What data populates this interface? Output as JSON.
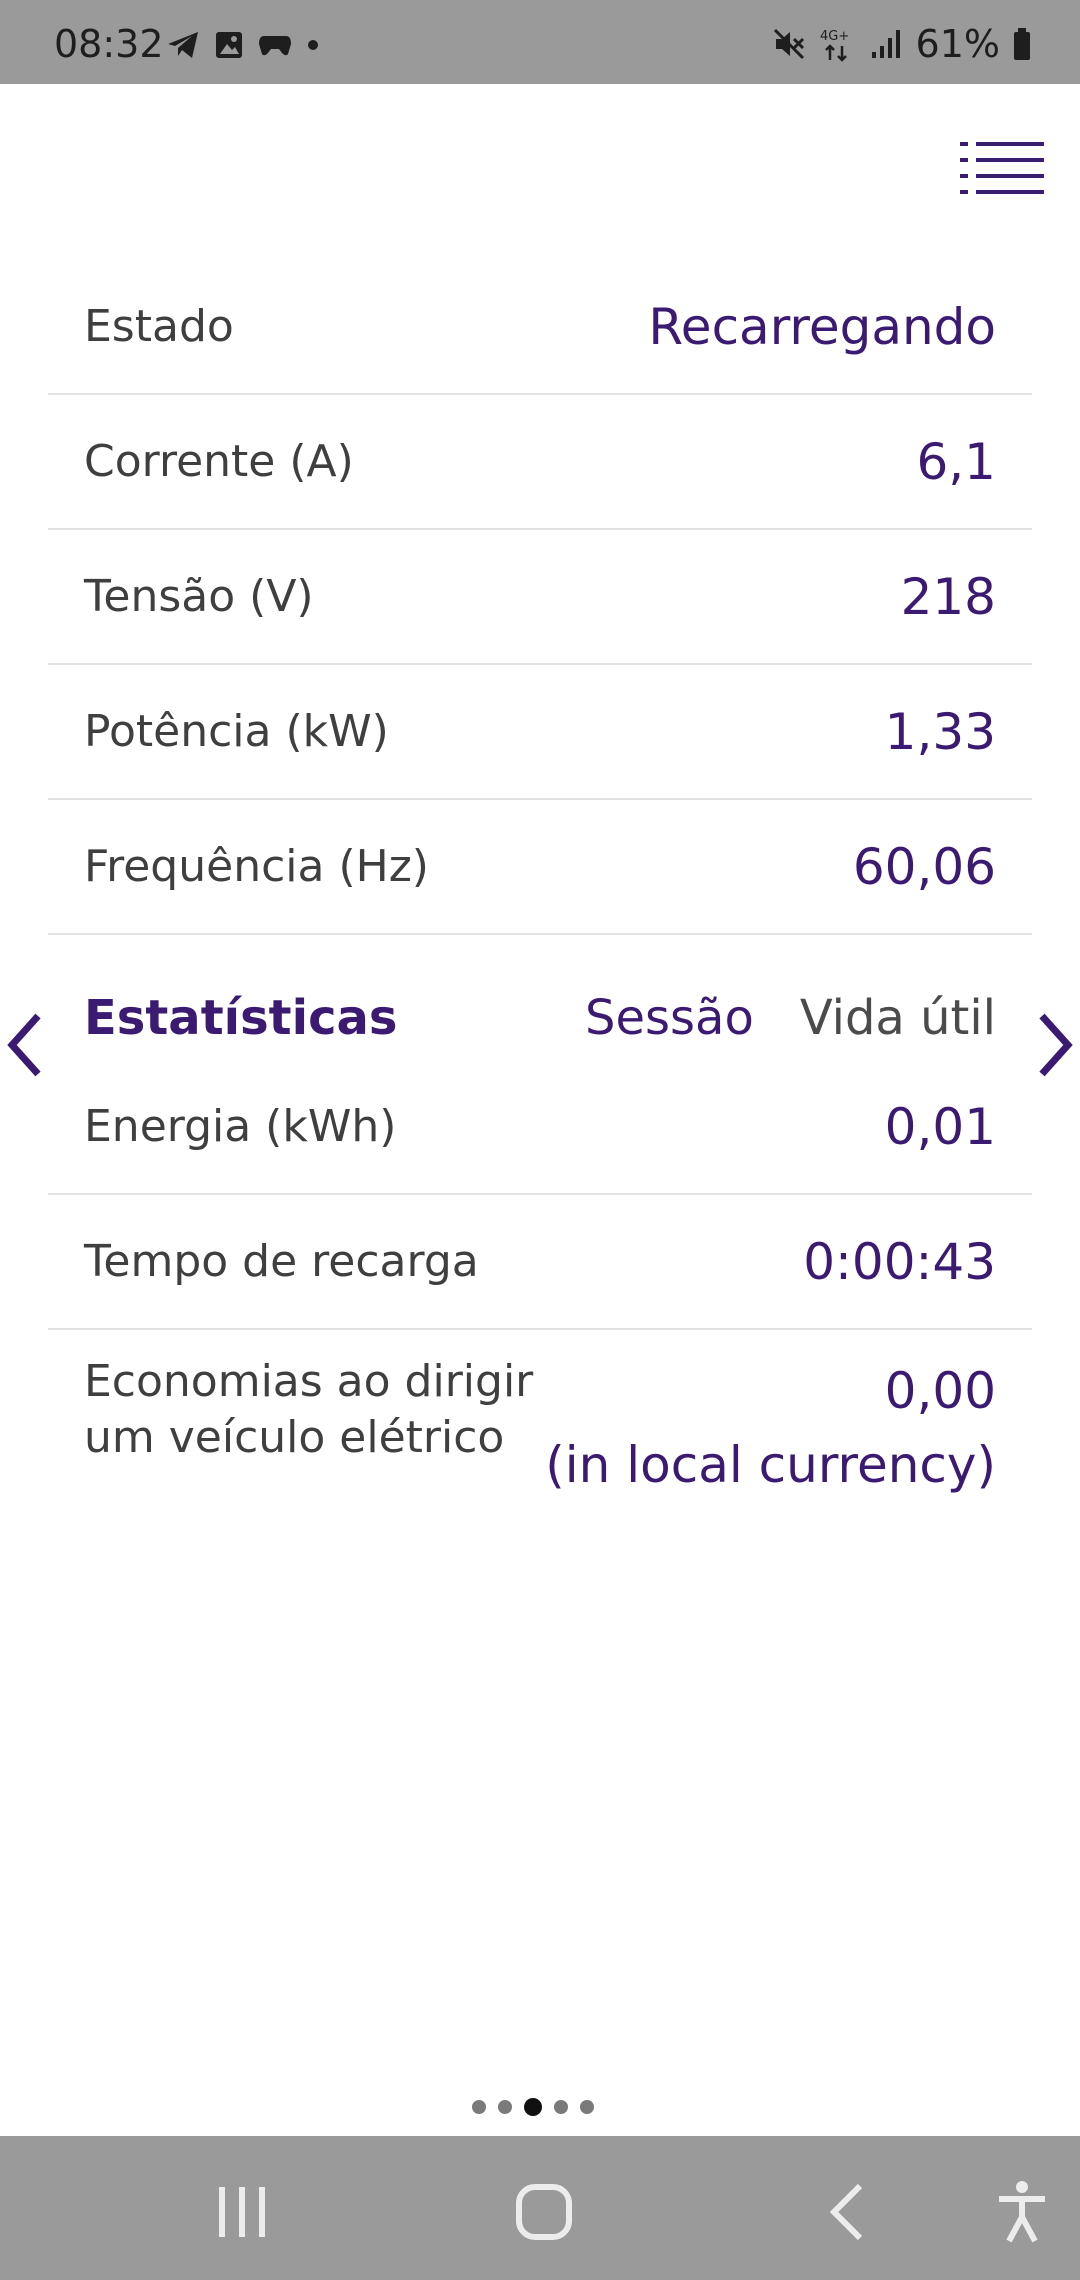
{
  "status_bar": {
    "time": "08:32",
    "battery": "61%",
    "network": "4G+",
    "left_icons": [
      "telegram-icon",
      "gallery-icon",
      "game-controller-icon",
      "dot-icon"
    ],
    "right_icons": [
      "mute-icon",
      "network-4g-icon",
      "signal-icon",
      "battery-icon"
    ]
  },
  "menu": {
    "icon": "list-menu-icon"
  },
  "readings": [
    {
      "label": "Estado",
      "value": "Recarregando"
    },
    {
      "label": "Corrente (A)",
      "value": "6,1"
    },
    {
      "label": "Tensão (V)",
      "value": "218"
    },
    {
      "label": "Potência (kW)",
      "value": "1,33"
    },
    {
      "label": "Frequência (Hz)",
      "value": "60,06"
    }
  ],
  "statistics": {
    "title": "Estatísticas",
    "tabs": [
      {
        "label": "Sessão",
        "active": true
      },
      {
        "label": "Vida útil",
        "active": false
      }
    ],
    "rows": [
      {
        "label": "Energia (kWh)",
        "value": "0,01"
      },
      {
        "label": "Tempo de recarga",
        "value": "0:00:43"
      },
      {
        "label_line1": "Economias ao dirigir",
        "label_line2": "um veículo elétrico",
        "value_line1": "0,00",
        "value_line2": "(in local currency)"
      }
    ]
  },
  "pager": {
    "count": 5,
    "active_index": 2
  },
  "navigation": {
    "buttons": [
      "recent-apps-icon",
      "home-icon",
      "back-icon",
      "accessibility-icon"
    ]
  },
  "colors": {
    "accent": "#3b1a72",
    "label": "#3f3f3f",
    "system_bar": "#9a9a9a",
    "divider": "#e2e2e2"
  }
}
